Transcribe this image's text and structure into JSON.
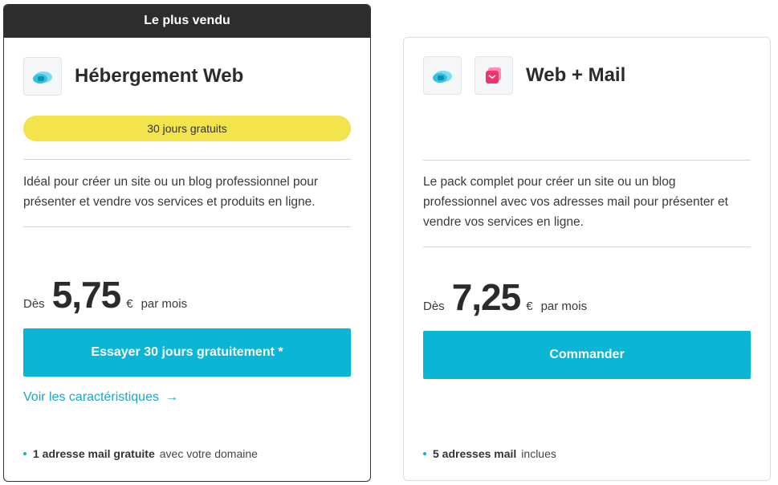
{
  "plans": [
    {
      "ribbon": "Le plus vendu",
      "icons": [
        "cloud-icon"
      ],
      "title": "Hébergement Web",
      "badge": "30 jours gratuits",
      "description": "Idéal pour créer un site ou un blog professionnel pour présenter et vendre vos services et produits en ligne.",
      "price_from": "Dès",
      "price": "5,75",
      "currency": "€",
      "period": "par mois",
      "cta": "Essayer 30 jours gratuitement *",
      "link": "Voir les caractéristiques",
      "link_icon": "arrow-right-icon",
      "feature_strong": "1 adresse mail gratuite",
      "feature_rest": "avec votre domaine"
    },
    {
      "icons": [
        "cloud-icon",
        "mail-cube-icon"
      ],
      "title": "Web + Mail",
      "description": "Le pack complet pour créer un site ou un blog professionnel avec vos adresses mail pour présenter et vendre vos services en ligne.",
      "price_from": "Dès",
      "price": "7,25",
      "currency": "€",
      "period": "par mois",
      "cta": "Commander",
      "feature_strong": "5 adresses mail",
      "feature_rest": "inclues"
    }
  ],
  "colors": {
    "accent": "#0ab5d6",
    "badge": "#f3e34c",
    "ribbon": "#2d2d2d",
    "link": "#1aa6c6"
  }
}
